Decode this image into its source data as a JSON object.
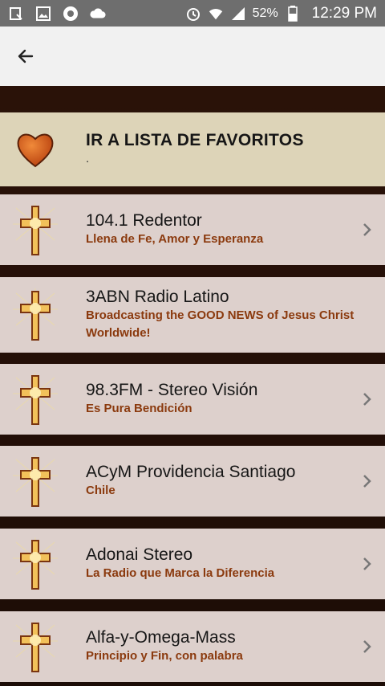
{
  "status_bar": {
    "battery_percent": "52%",
    "time": "12:29 PM",
    "left_icons": [
      "download-icon",
      "image-icon",
      "chrome-icon",
      "cloud-icon"
    ],
    "right_icons": [
      "alarm-icon",
      "wifi-icon",
      "signal-icon",
      "battery-icon"
    ]
  },
  "appbar": {
    "back_icon": "arrow-left-icon"
  },
  "favorites": {
    "title": "IR A LISTA DE FAVORITOS",
    "subtitle": ".",
    "icon": "heart-icon",
    "color": "#c9541b"
  },
  "stations": [
    {
      "name": "104.1 Redentor",
      "slogan": "Llena de Fe, Amor y Esperanza"
    },
    {
      "name": "3ABN Radio Latino",
      "slogan": "Broadcasting the GOOD NEWS of Jesus Christ Worldwide!"
    },
    {
      "name": "98.3FM - Stereo Visión",
      "slogan": "Es Pura Bendición"
    },
    {
      "name": "ACyM Providencia Santiago",
      "slogan": "Chile"
    },
    {
      "name": "Adonai Stereo",
      "slogan": "La Radio que Marca la Diferencia"
    },
    {
      "name": "Alfa-y-Omega-Mass",
      "slogan": "Principio y Fin, con palabra"
    }
  ],
  "colors": {
    "slogan": "#8b3a0e",
    "row_bg": "#ddd0cc",
    "fav_bg": "#ddd4b8",
    "appbar_bg": "#f1f1f1"
  }
}
